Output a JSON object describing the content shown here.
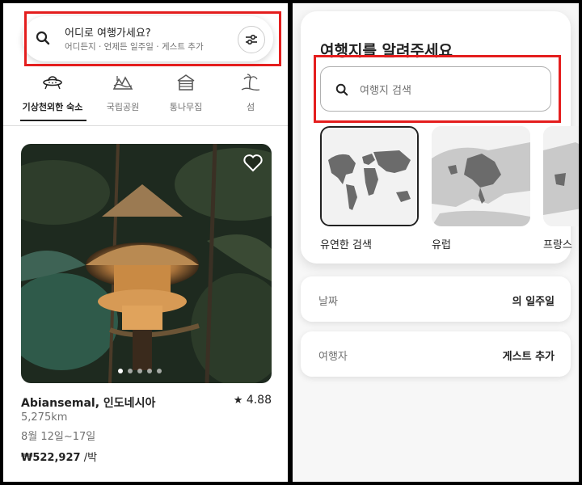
{
  "left": {
    "search": {
      "title": "어디로 여행가세요?",
      "subtitle": "어디든지 · 언제든 일주일 · 게스트 추가"
    },
    "categories": [
      {
        "label": "기상천외한 숙소",
        "icon": "ufo-icon",
        "active": true
      },
      {
        "label": "국립공원",
        "icon": "national-park-icon",
        "active": false
      },
      {
        "label": "통나무집",
        "icon": "cabin-icon",
        "active": false
      },
      {
        "label": "섬",
        "icon": "island-icon",
        "active": false
      }
    ],
    "listing": {
      "title": "Abiansemal, 인도네시아",
      "rating": "4.88",
      "distance": "5,275km",
      "dates": "8월 12일~17일",
      "price": "₩522,927",
      "price_unit": " /박",
      "photo_count": 5,
      "photo_index": 0
    }
  },
  "right": {
    "title": "여행지를 알려주세요",
    "search_placeholder": "여행지 검색",
    "regions": [
      {
        "label": "유연한 검색",
        "selected": true
      },
      {
        "label": "유럽",
        "selected": false
      },
      {
        "label": "프랑스",
        "selected": false
      }
    ],
    "date_row": {
      "label": "날짜",
      "value": "의 일주일"
    },
    "guest_row": {
      "label": "여행자",
      "value": "게스트 추가"
    }
  },
  "colors": {
    "highlight": "#e41e1e",
    "text": "#222222",
    "muted": "#717171",
    "map_land": "#6b6b6b"
  }
}
